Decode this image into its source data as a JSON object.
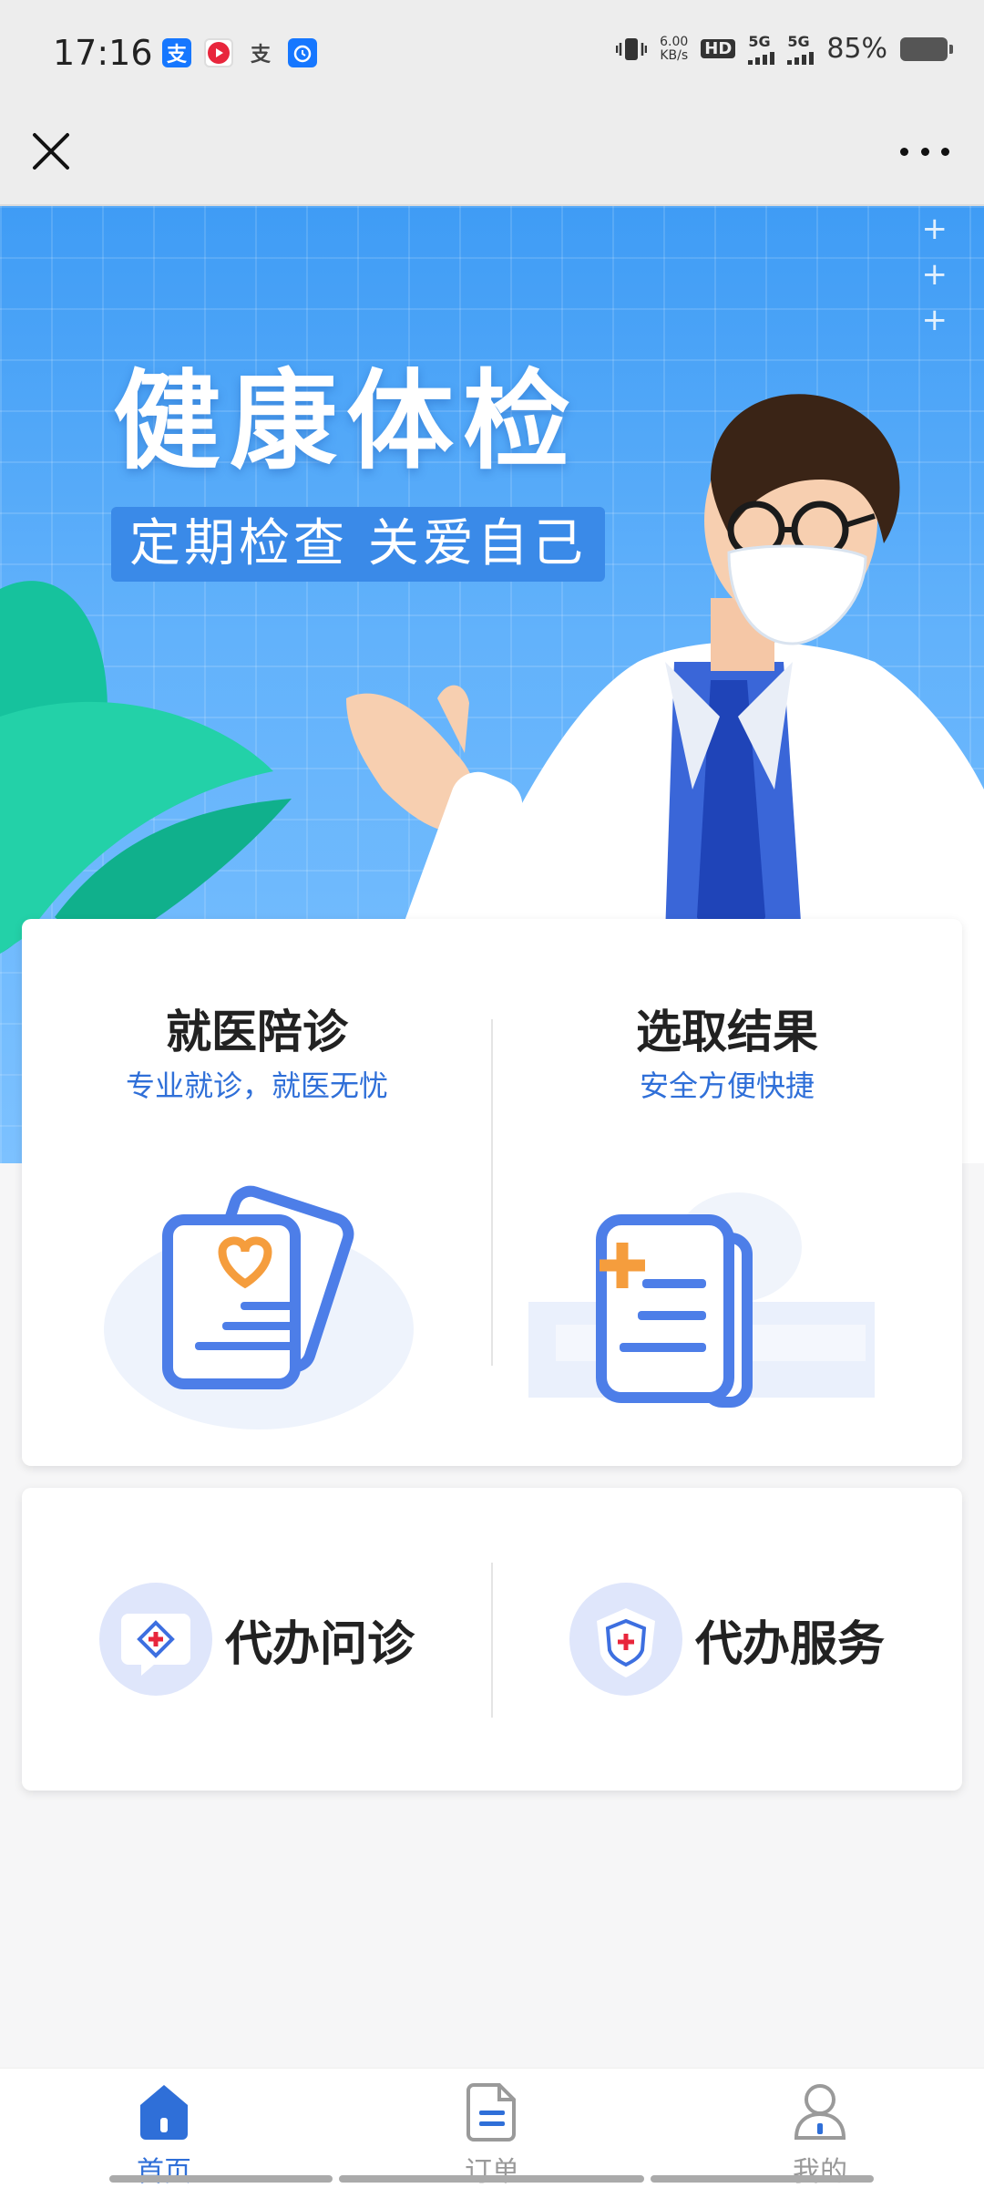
{
  "status_bar": {
    "time": "17:16",
    "speed_value": "6.00",
    "speed_unit": "KB/s",
    "hd": "HD",
    "network_1": "5G",
    "network_2": "5G",
    "battery": "85%",
    "app_icons": [
      "alipay-icon",
      "video-icon",
      "alipay-gray-icon",
      "alarm-icon"
    ]
  },
  "title_bar": {
    "close_icon": "close-icon",
    "more_icon": "more-icon"
  },
  "banner": {
    "title": "健康体检",
    "subtitle": "定期检查 关爱自己",
    "colors": {
      "sky": "#4aa3f7",
      "leaf": "#19c6a0",
      "coat": "#ffffff",
      "tie": "#1f44b8",
      "folder": "#f7a62a"
    }
  },
  "services": [
    {
      "title": "就医陪诊",
      "subtitle": "专业就诊，就医无忧",
      "icon": "medical-document-heart-icon"
    },
    {
      "title": "选取结果",
      "subtitle": "安全方便快捷",
      "icon": "medical-report-icon"
    }
  ],
  "quick_services": [
    {
      "label": "代办问诊",
      "icon": "chat-medical-icon"
    },
    {
      "label": "代办服务",
      "icon": "shield-medical-icon"
    }
  ],
  "bottom_nav": {
    "items": [
      {
        "label": "首页",
        "icon": "home-icon",
        "active": true
      },
      {
        "label": "订单",
        "icon": "order-document-icon",
        "active": false
      },
      {
        "label": "我的",
        "icon": "user-icon",
        "active": false
      }
    ]
  },
  "accent_color": "#2f6fd8"
}
